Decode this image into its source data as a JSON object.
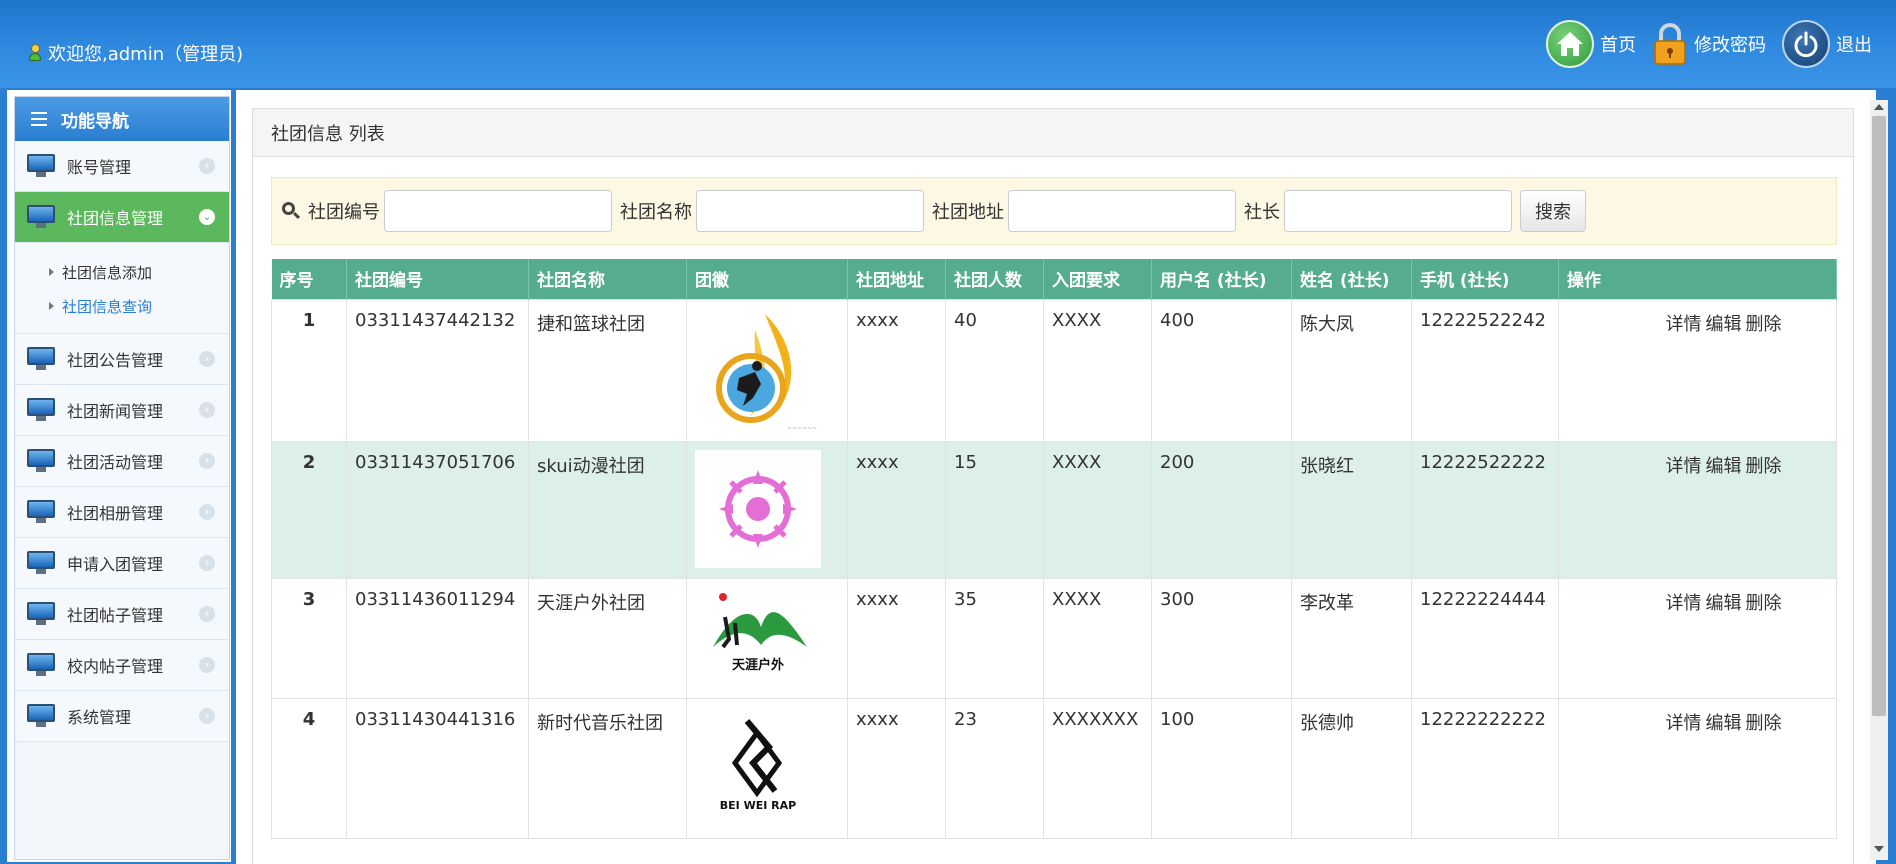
{
  "header": {
    "welcome": "欢迎您,admin（管理员)",
    "actions": {
      "home": "首页",
      "change_password": "修改密码",
      "logout": "退出"
    }
  },
  "sidebar": {
    "title": "功能导航",
    "items": [
      {
        "label": "账号管理"
      },
      {
        "label": "社团信息管理"
      },
      {
        "label": "社团公告管理"
      },
      {
        "label": "社团新闻管理"
      },
      {
        "label": "社团活动管理"
      },
      {
        "label": "社团相册管理"
      },
      {
        "label": "申请入团管理"
      },
      {
        "label": "社团帖子管理"
      },
      {
        "label": "校内帖子管理"
      },
      {
        "label": "系统管理"
      }
    ],
    "sub_items": [
      {
        "label": "社团信息添加"
      },
      {
        "label": "社团信息查询"
      }
    ]
  },
  "panel": {
    "title": "社团信息 列表"
  },
  "search": {
    "fields": [
      {
        "label": "社团编号",
        "value": ""
      },
      {
        "label": "社团名称",
        "value": ""
      },
      {
        "label": "社团地址",
        "value": ""
      },
      {
        "label": "社长",
        "value": ""
      }
    ],
    "button": "搜索"
  },
  "table": {
    "columns": [
      "序号",
      "社团编号",
      "社团名称",
      "团徽",
      "社团地址",
      "社团人数",
      "入团要求",
      "用户名 (社长)",
      "姓名 (社长)",
      "手机 (社长)",
      "操作"
    ],
    "rows": [
      {
        "no": "1",
        "code": "03311437442132",
        "name": "捷和篮球社团",
        "logo": "basketball-logo",
        "address": "xxxx",
        "count": "40",
        "requirement": "XXXX",
        "username": "400",
        "leader": "陈大凤",
        "phone": "12222522242"
      },
      {
        "no": "2",
        "code": "03311437051706",
        "name": "skui动漫社团",
        "logo": "anime-logo",
        "address": "xxxx",
        "count": "15",
        "requirement": "XXXX",
        "username": "200",
        "leader": "张晓红",
        "phone": "12222522222"
      },
      {
        "no": "3",
        "code": "03311436011294",
        "name": "天涯户外社团",
        "logo": "outdoor-logo",
        "address": "xxxx",
        "count": "35",
        "requirement": "XXXX",
        "username": "300",
        "leader": "李改革",
        "phone": "12222224444"
      },
      {
        "no": "4",
        "code": "03311430441316",
        "name": "新时代音乐社团",
        "logo": "rap-logo",
        "address": "xxxx",
        "count": "23",
        "requirement": "XXXXXXX",
        "username": "100",
        "leader": "张德帅",
        "phone": "12222222222"
      }
    ],
    "ops": {
      "detail": "详情",
      "edit": "编辑",
      "delete": "删除"
    }
  },
  "logo_text": {
    "outdoor": "天涯户外",
    "rap": "BEI WEI RAP"
  },
  "colors": {
    "header": "#2f8ae0",
    "active_nav": "#5cb85c",
    "table_header": "#55ad8e",
    "alt_row": "#dcefe8",
    "search_bg": "#fcf8e3"
  }
}
